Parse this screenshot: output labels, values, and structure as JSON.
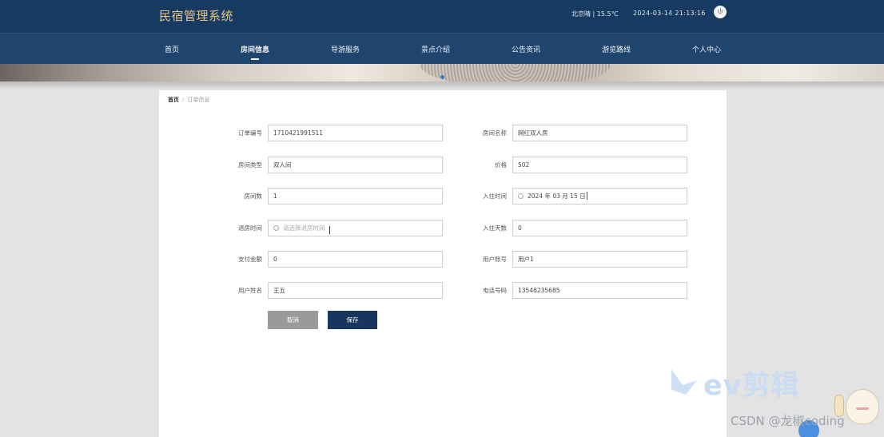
{
  "header": {
    "brand": "民宿管理系统",
    "weather": "北京晴 | 15.5℃",
    "datetime": "2024-03-14   21:13:16",
    "power_icon": "power-icon"
  },
  "nav": {
    "items": [
      {
        "label": "首页",
        "active": false
      },
      {
        "label": "房间信息",
        "active": true
      },
      {
        "label": "导游服务",
        "active": false
      },
      {
        "label": "景点介绍",
        "active": false
      },
      {
        "label": "公告资讯",
        "active": false
      },
      {
        "label": "游览路线",
        "active": false
      },
      {
        "label": "个人中心",
        "active": false
      }
    ]
  },
  "breadcrumb": {
    "home": "首页",
    "separator": "/",
    "current": "订单信息"
  },
  "form": {
    "order_no": {
      "label": "订单编号",
      "value": "1710421991511"
    },
    "room_name": {
      "label": "房间名称",
      "value": "网红双人房"
    },
    "room_type": {
      "label": "房间类型",
      "value": "双人间"
    },
    "price": {
      "label": "价格",
      "value": "502"
    },
    "room_count": {
      "label": "房间数",
      "value": "1"
    },
    "checkin_time": {
      "label": "入住时间",
      "value": "2024 年 03 月 15 日"
    },
    "checkout_time": {
      "label": "退房时间",
      "placeholder": "请选择退房时间"
    },
    "stay_days": {
      "label": "入住天数",
      "value": "0"
    },
    "payment": {
      "label": "支付金额",
      "value": "0"
    },
    "user_account": {
      "label": "用户账号",
      "value": "用户1"
    },
    "user_name": {
      "label": "用户姓名",
      "value": "王五"
    },
    "phone": {
      "label": "电话号码",
      "value": "13548235685"
    }
  },
  "buttons": {
    "cancel": "取消",
    "save": "保存"
  },
  "watermark": {
    "logo_text": "ev剪辑",
    "csdn": "CSDN @龙椒coding"
  },
  "colors": {
    "header_bg": "#173a62",
    "nav_bg": "#1f446d",
    "brand": "#e7c585",
    "save_btn": "#17365d",
    "cancel_btn": "#9a9a9a"
  }
}
